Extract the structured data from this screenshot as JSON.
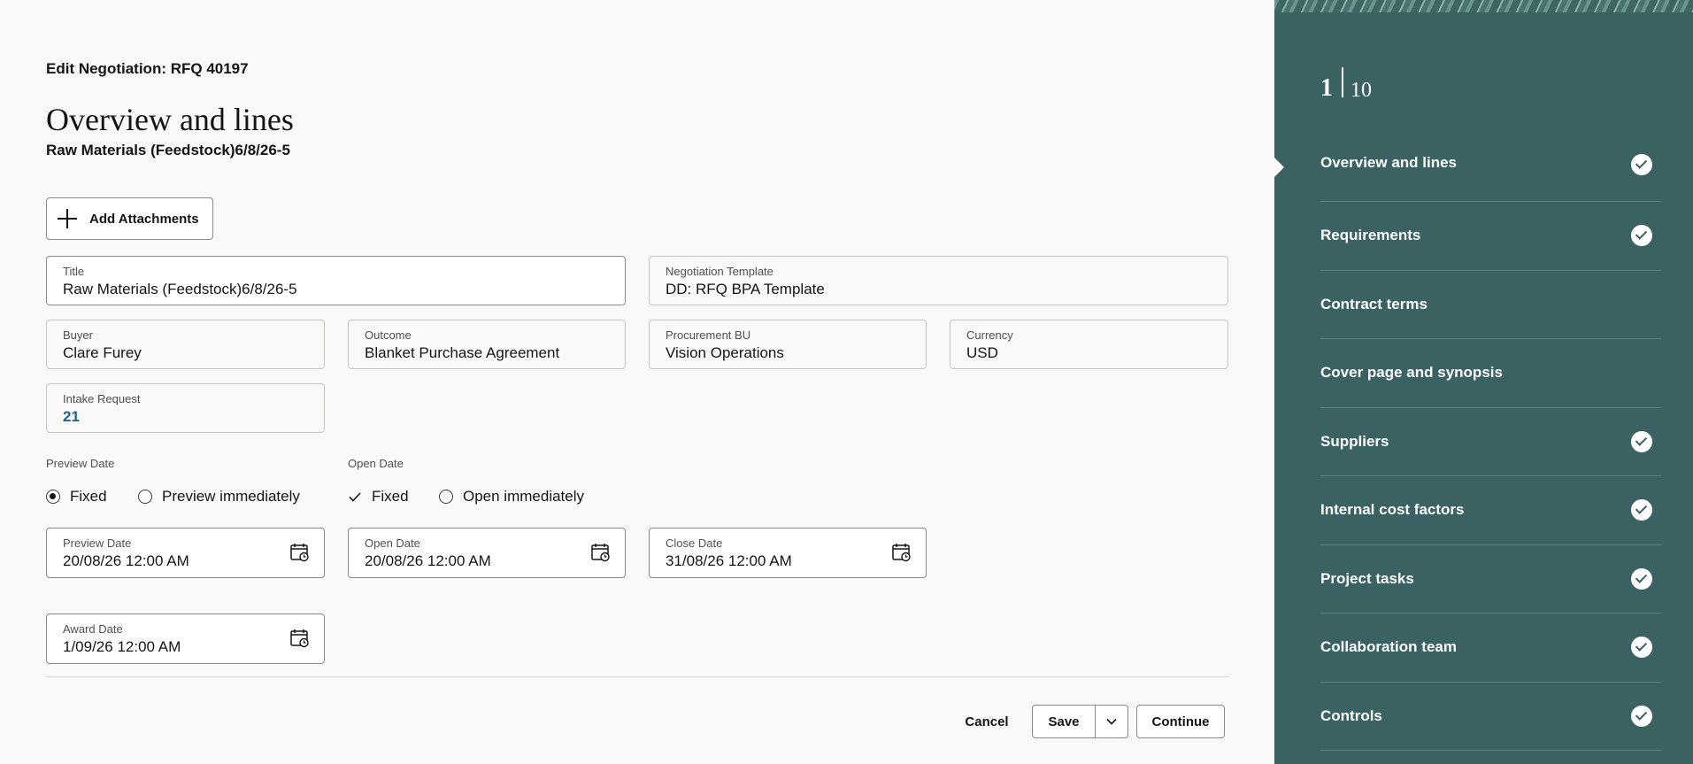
{
  "header": {
    "breadcrumb": "Edit Negotiation: RFQ 40197",
    "title": "Overview and lines",
    "subtitle": "Raw Materials (Feedstock)6/8/26-5"
  },
  "actions": {
    "add_attachments": "Add Attachments",
    "cancel": "Cancel",
    "save": "Save",
    "continue": "Continue"
  },
  "fields": {
    "title": {
      "label": "Title",
      "value": "Raw Materials (Feedstock)6/8/26-5"
    },
    "negotiation_template": {
      "label": "Negotiation Template",
      "value": "DD: RFQ BPA Template"
    },
    "buyer": {
      "label": "Buyer",
      "value": "Clare Furey"
    },
    "outcome": {
      "label": "Outcome",
      "value": "Blanket Purchase Agreement"
    },
    "procurement_bu": {
      "label": "Procurement BU",
      "value": "Vision Operations"
    },
    "currency": {
      "label": "Currency",
      "value": "USD"
    },
    "intake_request": {
      "label": "Intake Request",
      "value": "21"
    },
    "preview_date": {
      "label": "Preview Date",
      "value": "20/08/26 12:00 AM"
    },
    "open_date": {
      "label": "Open Date",
      "value": "20/08/26 12:00 AM"
    },
    "close_date": {
      "label": "Close Date",
      "value": "31/08/26 12:00 AM"
    },
    "award_date": {
      "label": "Award Date",
      "value": "1/09/26 12:00 AM"
    }
  },
  "preview_options": {
    "label": "Preview Date",
    "fixed": "Fixed",
    "immediately": "Preview immediately",
    "selected": "Fixed"
  },
  "open_options": {
    "label": "Open Date",
    "fixed": "Fixed",
    "immediately": "Open immediately",
    "selected": "Fixed"
  },
  "train": {
    "current": "1",
    "total": "10",
    "steps": [
      {
        "label": "Overview and lines",
        "complete": true
      },
      {
        "label": "Requirements",
        "complete": true
      },
      {
        "label": "Contract terms",
        "complete": false
      },
      {
        "label": "Cover page and synopsis",
        "complete": false
      },
      {
        "label": "Suppliers",
        "complete": true
      },
      {
        "label": "Internal cost factors",
        "complete": true
      },
      {
        "label": "Project tasks",
        "complete": true
      },
      {
        "label": "Collaboration team",
        "complete": true
      },
      {
        "label": "Controls",
        "complete": true
      }
    ]
  },
  "colors": {
    "panel": "#3a6262",
    "link": "#20638c",
    "background": "#faf9f7"
  }
}
